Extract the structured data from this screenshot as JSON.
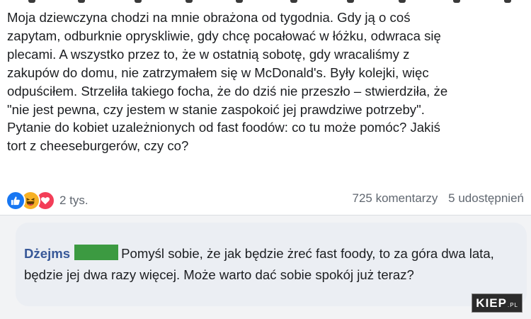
{
  "post": {
    "text": "Moja dziewczyna chodzi na mnie obrażona od tygodnia. Gdy ją o coś\nzapytam, odburknie opryskliwie, gdy chcę pocałować w łóżku, odwraca się\nplecami. A wszystko przez to, że w ostatnią sobotę, gdy wracaliśmy z\nzakupów do domu, nie zatrzymałem się w McDonald's. Były kolejki, więc\nodpuściłem. Strzeliła takiego focha, że do dziś nie przeszło – stwierdziła, że\n\"nie jest pewna, czy jestem w stanie zaspokoić jej prawdziwe potrzeby\".\nPytanie do kobiet uzależnionych od fast foodów: co tu może pomóc? Jakiś\ntort z cheeseburgerów, czy co?",
    "reactions": {
      "icons": [
        "like-icon",
        "haha-icon",
        "love-icon"
      ],
      "count": "2 tys."
    },
    "comments_count": "725 komentarzy",
    "shares_count": "5 udostępnień"
  },
  "comment": {
    "author": "Dżejms",
    "text": "Pomyśl sobie, że jak będzie żreć fast foody, to za góra dwa lata, będzie jej dwa razy więcej. Może warto dać sobie spokój już teraz?"
  },
  "watermark": {
    "brand": "KIEP",
    "suffix": ".PL"
  },
  "colors": {
    "like": "#1877f2",
    "haha": "#f7b125",
    "love": "#f33e58",
    "author": "#385898",
    "censor": "#3c9a41",
    "comment_bg": "#ebeef3"
  }
}
